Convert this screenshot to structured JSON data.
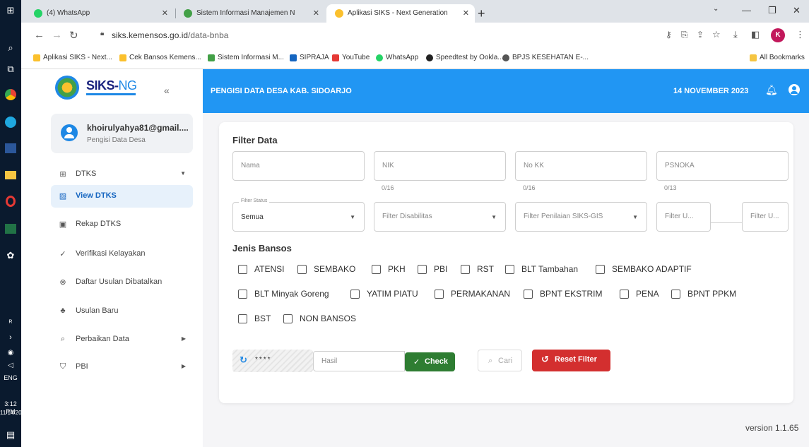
{
  "taskbar": {
    "language": "ENG",
    "time": "3:12 PM",
    "date": "11/14/2023"
  },
  "browser": {
    "tabs": [
      {
        "label": "(4) WhatsApp",
        "color": "#25d366"
      },
      {
        "label": "Sistem Informasi Manajemen N",
        "color": "#43a047"
      },
      {
        "label": "Aplikasi SIKS - Next Generation",
        "color": "#fbc02d"
      }
    ],
    "url_host": "siks.kemensos.go.id",
    "url_path": "/data-bnba",
    "profile_initial": "K",
    "bookmarks": [
      {
        "label": "Aplikasi SIKS - Next...",
        "color": "#fbc02d"
      },
      {
        "label": "Cek Bansos Kemens...",
        "color": "#fbc02d"
      },
      {
        "label": "Sistem Informasi M...",
        "color": "#43a047"
      },
      {
        "label": "SIPRAJA",
        "color": "#1565c0"
      },
      {
        "label": "YouTube",
        "color": "#e53935"
      },
      {
        "label": "WhatsApp",
        "color": "#25d366"
      },
      {
        "label": "Speedtest by Ookla...",
        "color": "#222222"
      },
      {
        "label": "BPJS KESEHATAN E-...",
        "color": "#555555"
      }
    ],
    "all_bookmarks": "All Bookmarks"
  },
  "sidebar": {
    "logo_text": "SIKS-",
    "logo_text_ng": "NG",
    "user_name": "khoirulyahya81@gmail....",
    "user_role": "Pengisi Data Desa",
    "items": [
      {
        "label": "DTKS",
        "icon": "table-icon"
      },
      {
        "label": "View DTKS",
        "icon": "view-icon"
      },
      {
        "label": "Rekap DTKS",
        "icon": "recap-icon"
      },
      {
        "label": "Verifikasi Kelayakan",
        "icon": "check-icon"
      },
      {
        "label": "Daftar Usulan Dibatalkan",
        "icon": "cancel-icon"
      },
      {
        "label": "Usulan Baru",
        "icon": "people-icon"
      },
      {
        "label": "Perbaikan Data",
        "icon": "search-icon"
      },
      {
        "label": "PBI",
        "icon": "shield-icon"
      }
    ]
  },
  "header": {
    "title": "PENGISI DATA DESA KAB. SIDOARJO",
    "date": "14 NOVEMBER 2023"
  },
  "filter": {
    "title": "Filter Data",
    "nama_placeholder": "Nama",
    "nik_placeholder": "NIK",
    "nik_counter": "0/16",
    "nokk_placeholder": "No KK",
    "nokk_counter": "0/16",
    "psnoka_placeholder": "PSNOKA",
    "psnoka_counter": "0/13",
    "status_legend": "Filter Status",
    "status_value": "Semua",
    "disabilitas_placeholder": "Filter Disabilitas",
    "penilaian_placeholder": "Filter Penilaian SIKS-GIS",
    "umur1_placeholder": "Filter U...",
    "umur2_placeholder": "Filter U..."
  },
  "bansos": {
    "title": "Jenis Bansos",
    "options": [
      "ATENSI",
      "SEMBAKO",
      "PKH",
      "PBI",
      "RST",
      "BLT Tambahan",
      "SEMBAKO ADAPTIF",
      "BLT Minyak Goreng",
      "YATIM PIATU",
      "PERMAKANAN",
      "BPNT EKSTRIM",
      "PENA",
      "BPNT PPKM",
      "BST",
      "NON BANSOS"
    ]
  },
  "actions": {
    "captcha_code": "****",
    "hasil_placeholder": "Hasil",
    "check_label": "Check",
    "cari_label": "Cari",
    "reset_label": "Reset Filter"
  },
  "version": "version 1.1.65"
}
